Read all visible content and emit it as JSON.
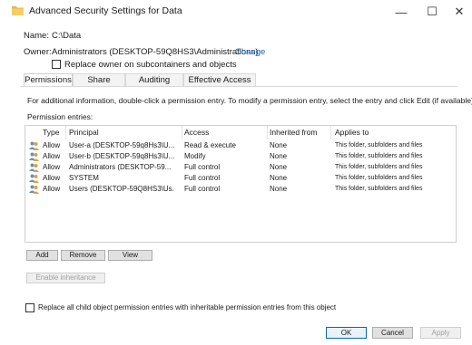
{
  "window": {
    "title": "Advanced Security Settings for Data",
    "minimize_glyph": "—",
    "maximize_glyph": "☐",
    "close_glyph": "✕"
  },
  "name": {
    "label": "Name:",
    "value": "C:\\Data"
  },
  "owner": {
    "label": "Owner:",
    "value": "Administrators (DESKTOP-59Q8HS3\\Administrations)",
    "change_link": "Change",
    "replace_owner_label": "Replace owner on subcontainers and objects",
    "replace_owner_checked": false
  },
  "tabs": [
    {
      "label": "Permissions",
      "active": true
    },
    {
      "label": "Share",
      "active": false
    },
    {
      "label": "Auditing",
      "active": false
    },
    {
      "label": "Effective Access",
      "active": false
    }
  ],
  "info_text": "For additional information, double-click a permission entry. To modify a permission entry, select the entry and click Edit (if available).",
  "entries_label": "Permission entries:",
  "columns": {
    "type": "Type",
    "principal": "Principal",
    "access": "Access",
    "inherited_from": "Inherited from",
    "applies_to": "Applies to"
  },
  "rows": [
    {
      "type": "Allow",
      "principal": "User-a (DESKTOP-59q8Hs3\\U...",
      "access": "Read & execute",
      "inherited_from": "None",
      "applies_to": "This folder, subfolders and files"
    },
    {
      "type": "Allow",
      "principal": "User-b (DESKTOP-59q8Hs3\\U...",
      "access": "Modify",
      "inherited_from": "None",
      "applies_to": "This folder, subfolders and files"
    },
    {
      "type": "Allow",
      "principal": "Administrators (DESKTOP-59...",
      "access": "Full control",
      "inherited_from": "None",
      "applies_to": "This folder, subfolders and files"
    },
    {
      "type": "Allow",
      "principal": "SYSTEM",
      "access": "Full control",
      "inherited_from": "None",
      "applies_to": "This folder, subfolders and files"
    },
    {
      "type": "Allow",
      "principal": "Users (DESKTOP-59Q8HS3\\Us.",
      "access": "Full control",
      "inherited_from": "None",
      "applies_to": "This folder, subfolders and files"
    }
  ],
  "buttons": {
    "add": "Add",
    "remove": "Remove",
    "view": "View",
    "enable_inheritance": "Enable inheritance",
    "ok": "OK",
    "cancel": "Cancel",
    "apply": "Apply"
  },
  "replace_child": {
    "label": "Replace all child object permission entries with inheritable permission entries from this object",
    "checked": false
  },
  "colors": {
    "accent": "#0067c0",
    "link": "#1a5fb4",
    "folder": "#e8b64a"
  }
}
